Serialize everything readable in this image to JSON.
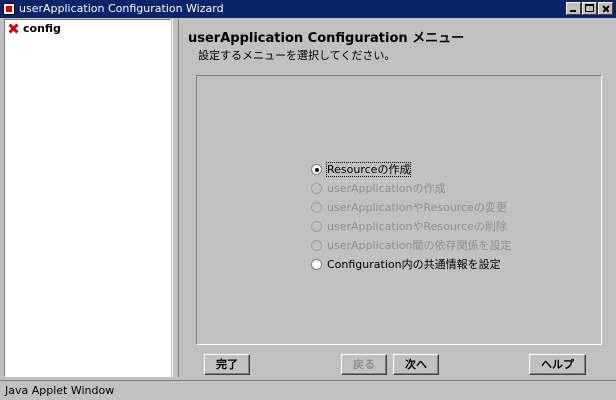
{
  "window": {
    "title": "userApplication Configuration Wizard",
    "buttons": [
      "minimize",
      "maximize",
      "close"
    ]
  },
  "tree": {
    "root_label": "config",
    "root_icon": "config-icon"
  },
  "main": {
    "heading": "userApplication Configuration メニュー",
    "subtitle": "設定するメニューを選択してください。",
    "options": [
      {
        "label": "Resourceの作成",
        "selected": true,
        "enabled": true
      },
      {
        "label": "userApplicationの作成",
        "selected": false,
        "enabled": false
      },
      {
        "label": "userApplicationやResourceの変更",
        "selected": false,
        "enabled": false
      },
      {
        "label": "userApplicationやResourceの削除",
        "selected": false,
        "enabled": false
      },
      {
        "label": "userApplication間の依存関係を設定",
        "selected": false,
        "enabled": false
      },
      {
        "label": "Configuration内の共通情報を設定",
        "selected": false,
        "enabled": true
      }
    ]
  },
  "footer": {
    "finish_label": "完了",
    "back_label": "戻る",
    "next_label": "次へ",
    "help_label": "ヘルプ",
    "back_enabled": false
  },
  "status": {
    "text": "Java Applet Window"
  }
}
